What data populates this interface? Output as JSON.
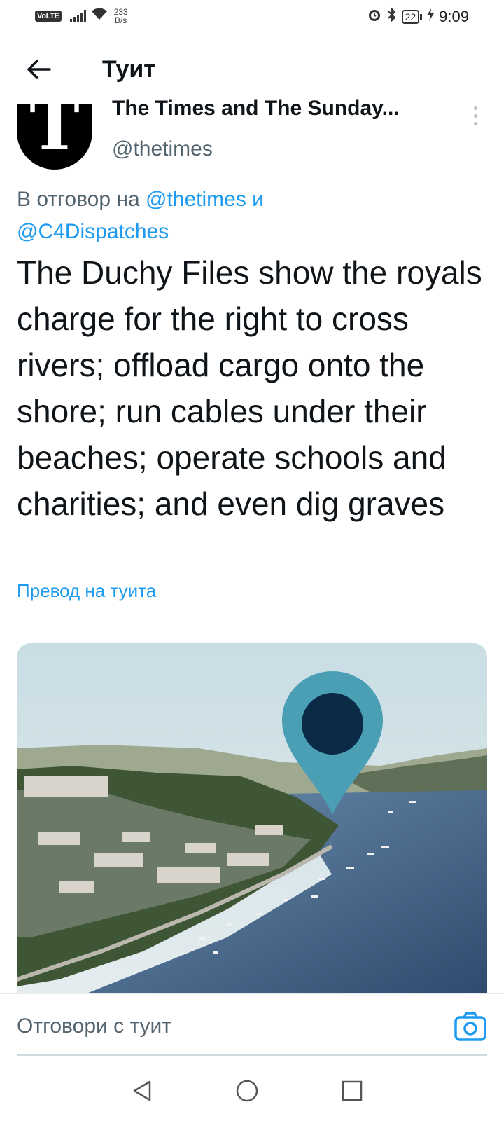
{
  "status_bar": {
    "network_badge": "VoLTE",
    "speed_value": "233",
    "speed_unit": "B/s",
    "battery_level": "22",
    "time": "9:09",
    "icons": [
      "signal-icon",
      "wifi-icon",
      "alarm-icon",
      "bluetooth-icon",
      "battery-icon",
      "charging-icon"
    ]
  },
  "header": {
    "title": "Туит",
    "back_icon": "arrow-left-icon"
  },
  "author": {
    "name": "The Times and The Sunday...",
    "handle": "@thetimes",
    "avatar_letter": "T"
  },
  "reply_context": {
    "prefix": "В отговор на",
    "mention_1": "@thetimes",
    "conjunction": "и",
    "mention_2": "@C4Dispatches"
  },
  "tweet": {
    "text": "The Duchy Files show the royals charge for the right to cross rivers; offload cargo onto the shore; run cables under their beaches; operate schools and charities; and even dig graves",
    "translate_label": "Превод на туита"
  },
  "media": {
    "description_icon": "map-pin-icon"
  },
  "reply_bar": {
    "placeholder": "Отговори с туит",
    "camera_icon": "camera-icon"
  },
  "nav_bar": {
    "icons": [
      "back-triangle-icon",
      "home-circle-icon",
      "recents-square-icon"
    ]
  },
  "colors": {
    "accent": "#1d9bf0",
    "text_primary": "#0f1419",
    "text_secondary": "#536471",
    "pin_color": "#4a9fb5",
    "pin_center": "#0b2a45"
  }
}
